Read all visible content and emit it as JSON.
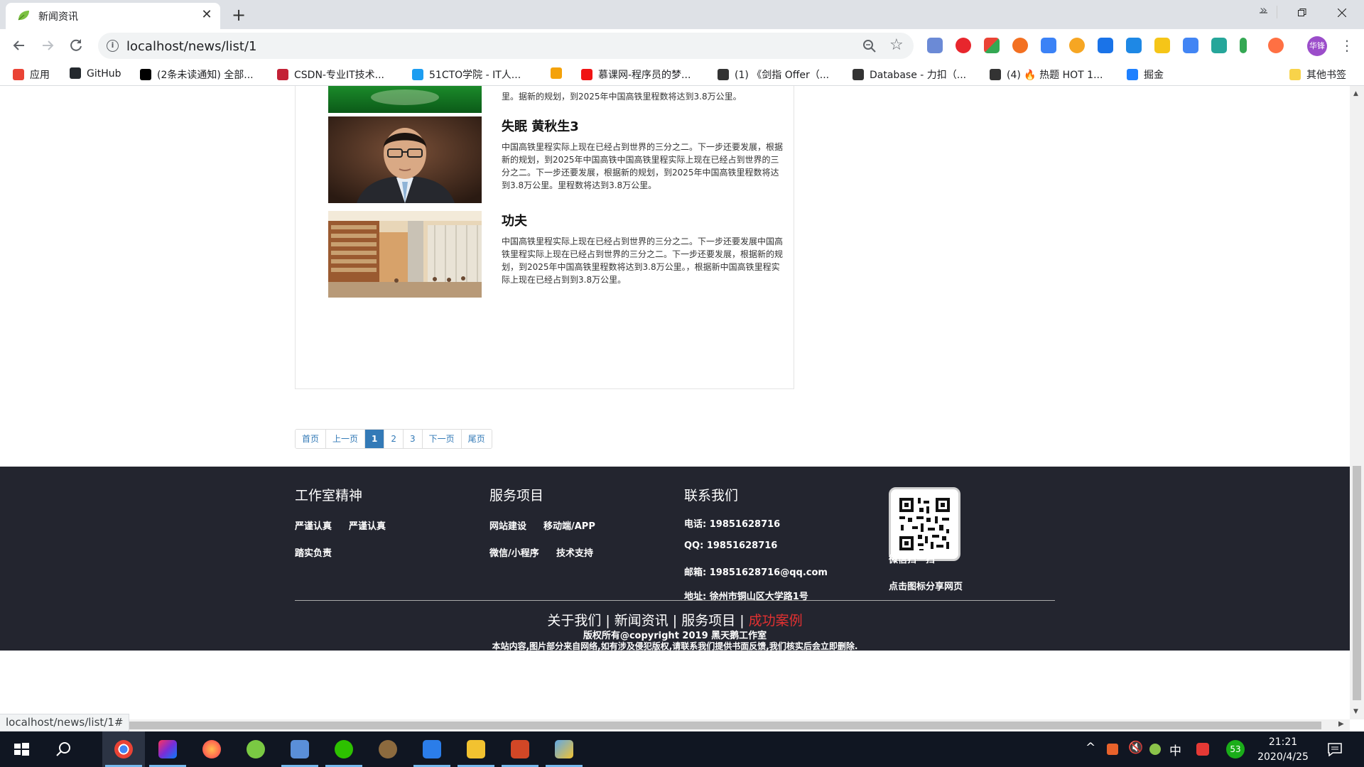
{
  "browser": {
    "tab_title": "新闻资讯",
    "tab_close": "✕",
    "new_tab": "+",
    "url": "localhost/news/list/1",
    "profile_label": "华锋",
    "status_url": "localhost/news/list/1#"
  },
  "bookmarks": [
    {
      "label": "应用",
      "icon": "apps-grid-icon",
      "color": "#ea4335"
    },
    {
      "label": "GitHub",
      "icon": "github-icon",
      "color": "#24292e"
    },
    {
      "label": "(2条未读通知) 全部...",
      "icon": "notification-icon",
      "color": "#000000"
    },
    {
      "label": "CSDN-专业IT技术...",
      "icon": "csdn-icon",
      "color": "#c32136"
    },
    {
      "label": "51CTO学院 - IT人...",
      "icon": "51cto-icon",
      "color": "#1c9df1"
    },
    {
      "label": "",
      "icon": "download-icon",
      "color": "#f4a20a"
    },
    {
      "label": "慕课网-程序员的梦...",
      "icon": "imooc-icon",
      "color": "#f01414"
    },
    {
      "label": "(1) 《剑指 Offer（...",
      "icon": "leetcode-icon",
      "color": "#333333"
    },
    {
      "label": "Database - 力扣（...",
      "icon": "leetcode-icon",
      "color": "#333333"
    },
    {
      "label": "(4) 🔥 热题 HOT 1...",
      "icon": "leetcode-icon",
      "color": "#333333"
    },
    {
      "label": "掘金",
      "icon": "juejin-icon",
      "color": "#1e80ff"
    }
  ],
  "bookmarks_more": "»",
  "bookmarks_other": "其他书签",
  "partial_news_text": "里。据新的规划，到2025年中国高铁里程数将达到3.8万公里。",
  "news": [
    {
      "title": "失眠 黄秋生3",
      "text": "中国高铁里程实际上现在已经占到世界的三分之二。下一步还要发展，根据新的规划，到2025年中国高铁中国高铁里程实际上现在已经占到世界的三分之二。下一步还要发展，根据新的规划，到2025年中国高铁里程数将达到3.8万公里。里程数将达到3.8万公里。",
      "image": "portrait-photo"
    },
    {
      "title": "功夫",
      "text": "中国高铁里程实际上现在已经占到世界的三分之二。下一步还要发展中国高铁里程实际上现在已经占到世界的三分之二。下一步还要发展，根据新的规划，到2025年中国高铁里程数将达到3.8万公里。，根据新中国高铁里程实际上现在已经占到到3.8万公里。",
      "image": "library-photo"
    }
  ],
  "pagination": [
    "首页",
    "上一页",
    "1",
    "2",
    "3",
    "下一页",
    "尾页"
  ],
  "pagination_active": "1",
  "footer": {
    "col1": {
      "title": "工作室精神",
      "items": [
        "严谨认真",
        "严谨认真",
        "踏实负责"
      ]
    },
    "col2": {
      "title": "服务项目",
      "items": [
        "网站建设",
        "移动端/APP",
        "微信/小程序",
        "技术支持"
      ]
    },
    "col3": {
      "title": "联系我们",
      "rows": [
        "电话:   19851628716",
        "QQ:    19851628716",
        "邮箱:   19851628716@qq.com",
        "地址:   徐州市铜山区大学路1号"
      ]
    },
    "qr_caption": "微信扫一扫",
    "qr_share": "点击图标分享网页",
    "nav": [
      "关于我们",
      "新闻资讯",
      "服务项目",
      "成功案例"
    ],
    "nav_sep": "|",
    "nav_highlight_color": "#e23131",
    "copyright": "版权所有@copyright 2019 黑天鹅工作室",
    "notice": "本站内容,图片部分来自网络,如有涉及侵犯版权,请联系我们提供书面反馈,我们核实后会立即删除."
  },
  "taskbar": {
    "time": "21:21",
    "date": "2020/4/25",
    "ime": "中",
    "badge": "53"
  }
}
